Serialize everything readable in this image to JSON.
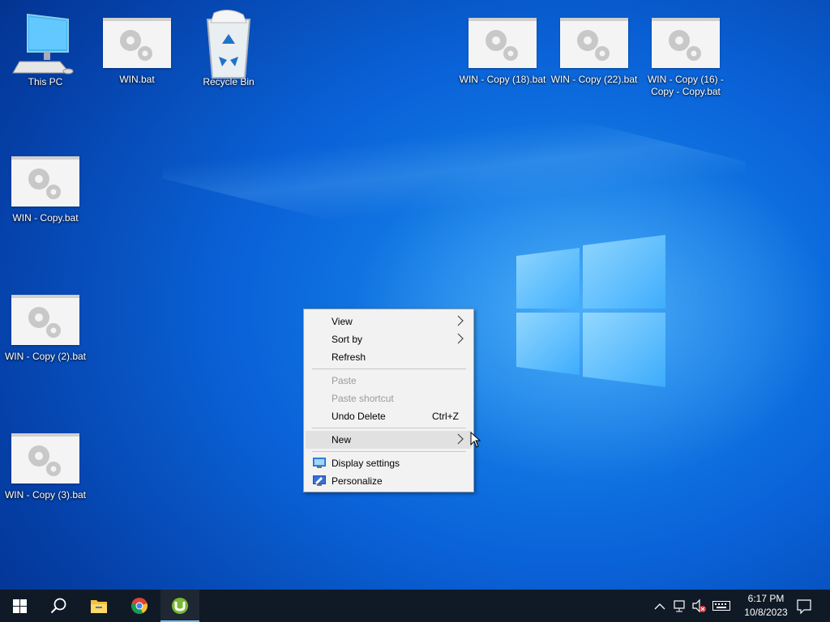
{
  "desktop": {
    "icons": [
      {
        "label": "This PC"
      },
      {
        "label": "WIN.bat"
      },
      {
        "label": "Recycle Bin"
      },
      {
        "label": "WIN - Copy (18).bat"
      },
      {
        "label": "WIN - Copy (22).bat"
      },
      {
        "label": "WIN - Copy (16) - Copy - Copy.bat"
      },
      {
        "label": "WIN - Copy.bat"
      },
      {
        "label": "WIN - Copy (2).bat"
      },
      {
        "label": "WIN - Copy (3).bat"
      }
    ]
  },
  "context_menu": {
    "view": "View",
    "sort_by": "Sort by",
    "refresh": "Refresh",
    "paste": "Paste",
    "paste_shortcut": "Paste shortcut",
    "undo_delete": "Undo Delete",
    "undo_shortcut": "Ctrl+Z",
    "new": "New",
    "display_settings": "Display settings",
    "personalize": "Personalize"
  },
  "taskbar": {
    "time": "6:17 PM",
    "date": "10/8/2023",
    "pinned": [
      "start-icon",
      "search-icon",
      "file-explorer-icon",
      "chrome-icon",
      "utorrent-icon"
    ],
    "accent": "#0a63d8"
  }
}
